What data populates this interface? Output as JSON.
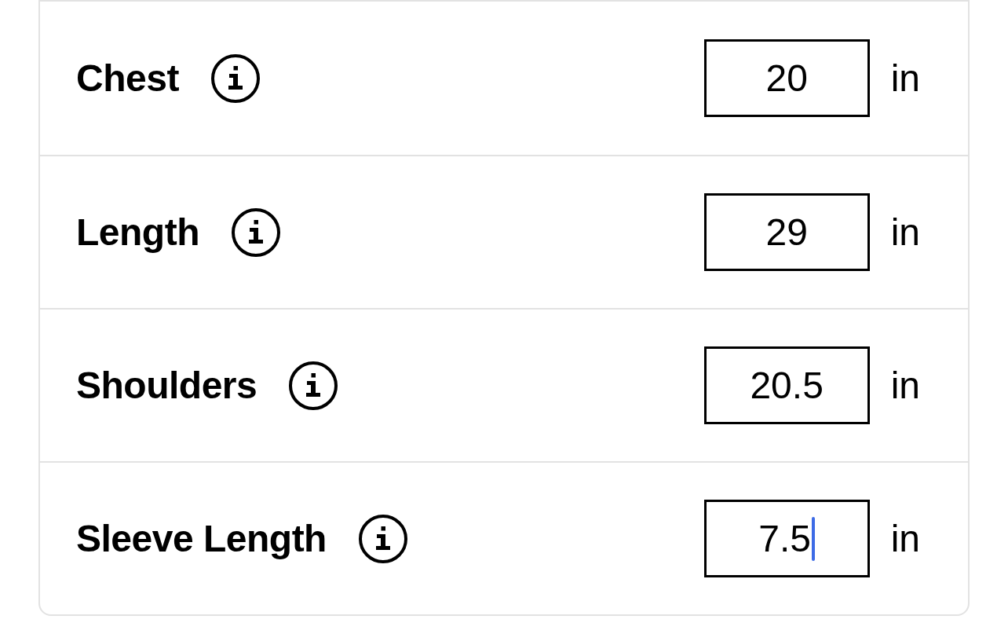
{
  "measurements": [
    {
      "label": "Chest",
      "value": "20",
      "unit": "in",
      "focused": false
    },
    {
      "label": "Length",
      "value": "29",
      "unit": "in",
      "focused": false
    },
    {
      "label": "Shoulders",
      "value": "20.5",
      "unit": "in",
      "focused": false
    },
    {
      "label": "Sleeve Length",
      "value": "7.5",
      "unit": "in",
      "focused": true
    }
  ]
}
